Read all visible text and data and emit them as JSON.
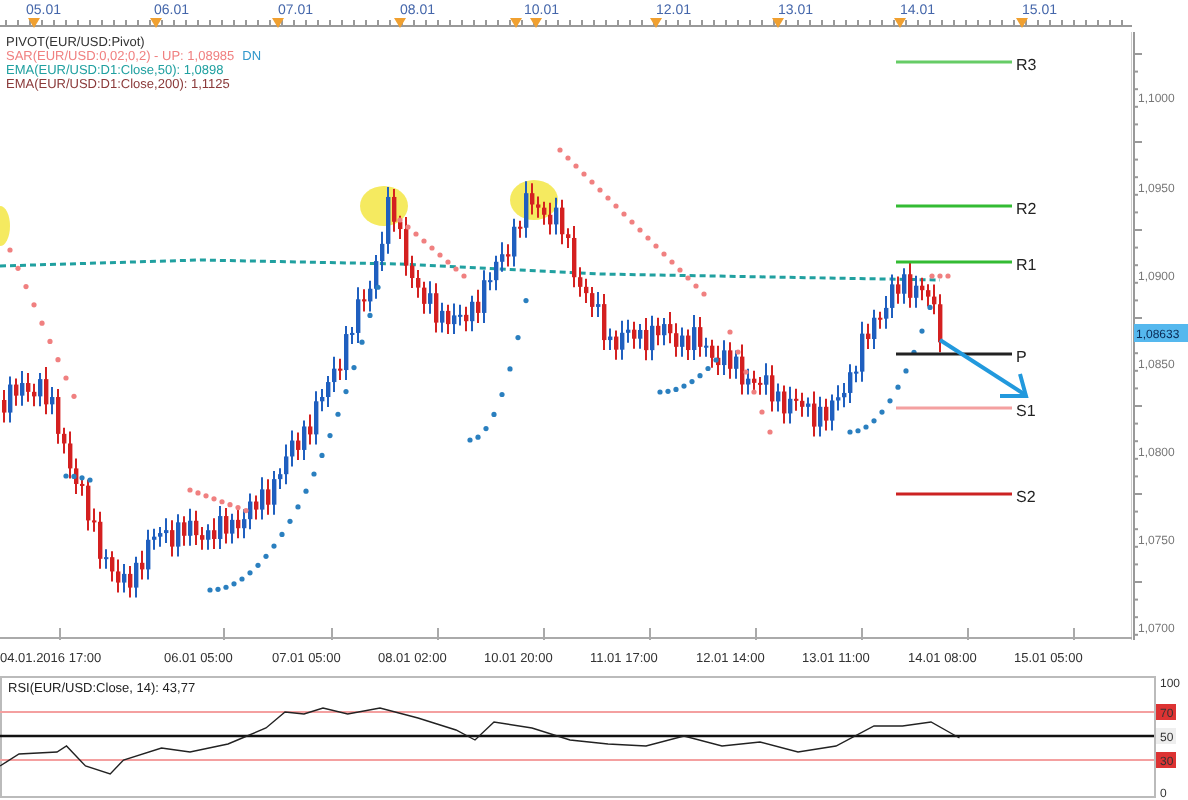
{
  "top_axis": {
    "dates": [
      "05.01",
      "06.01",
      "07.01",
      "08.01",
      "10.01",
      "12.01",
      "13.01",
      "14.01",
      "15.01"
    ]
  },
  "legend": [
    {
      "parts": [
        {
          "text": "PIVOT(EUR/USD:Pivot)",
          "color": "#333333"
        }
      ]
    },
    {
      "parts": [
        {
          "text": "SAR(EUR/USD:0,02;0,2) - UP: 1,08985",
          "color": "#f08080"
        },
        {
          "text": "DN",
          "color": "#3399cc"
        }
      ]
    },
    {
      "parts": [
        {
          "text": "EMA(EUR/USD:D1:Close,50): 1,0898",
          "color": "#20a0a0"
        }
      ]
    },
    {
      "parts": [
        {
          "text": "EMA(EUR/USD:D1:Close,200): 1,1125",
          "color": "#8b3a3a"
        }
      ]
    }
  ],
  "pivots": [
    {
      "label": "R3",
      "color": "#66cc66"
    },
    {
      "label": "R2",
      "color": "#33bb33"
    },
    {
      "label": "R1",
      "color": "#33bb33"
    },
    {
      "label": "P",
      "color": "#222222"
    },
    {
      "label": "S1",
      "color": "#f4a0a0"
    },
    {
      "label": "S2",
      "color": "#cc2222"
    }
  ],
  "price_axis": [
    "1,1000",
    "1,0950",
    "1,0900",
    "1,0850",
    "1,0800",
    "1,0750",
    "1,0700"
  ],
  "current_price": "1,08633",
  "time_axis": [
    "04.01.2016 17:00",
    "06.01 05:00",
    "07.01 05:00",
    "08.01 02:00",
    "10.01 20:00",
    "11.01 17:00",
    "12.01 14:00",
    "13.01 11:00",
    "14.01 08:00",
    "15.01 05:00"
  ],
  "rsi": {
    "label": "RSI(EUR/USD:Close, 14): 43,77",
    "ticks": [
      "100",
      "70",
      "50",
      "30",
      "0"
    ]
  }
}
